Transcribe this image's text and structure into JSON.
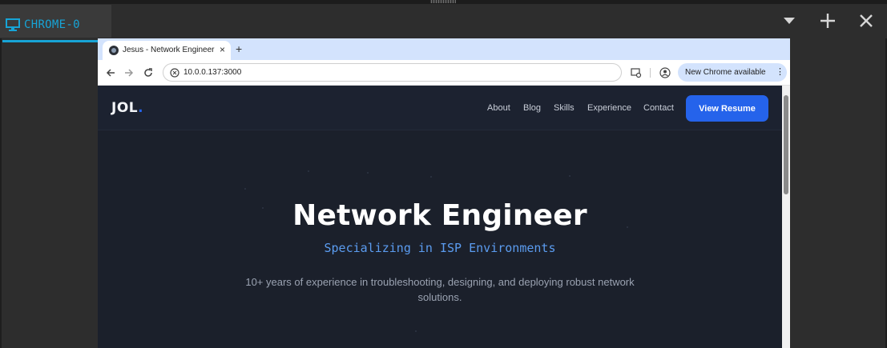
{
  "host": {
    "tab_label": "CHROME-0",
    "accent_color": "#17a4d6",
    "controls": [
      "chevron-down-icon",
      "plus-icon",
      "close-icon"
    ]
  },
  "browser": {
    "tab_title": "Jesus - Network Engineer",
    "tab_close": "×",
    "new_tab": "+",
    "url": "10.0.0.137:3000",
    "update_label": "New Chrome available",
    "update_menu": "⋮"
  },
  "site": {
    "logo_text": "JOL",
    "logo_dot": ".",
    "nav": [
      "About",
      "Blog",
      "Skills",
      "Experience",
      "Contact"
    ],
    "cta_label": "View Resume",
    "accent_color": "#2563eb",
    "hero": {
      "title": "Network Engineer",
      "subtitle": "Specializing in ISP Environments",
      "description": "10+ years of experience in troubleshooting, designing, and deploying robust network solutions."
    }
  }
}
